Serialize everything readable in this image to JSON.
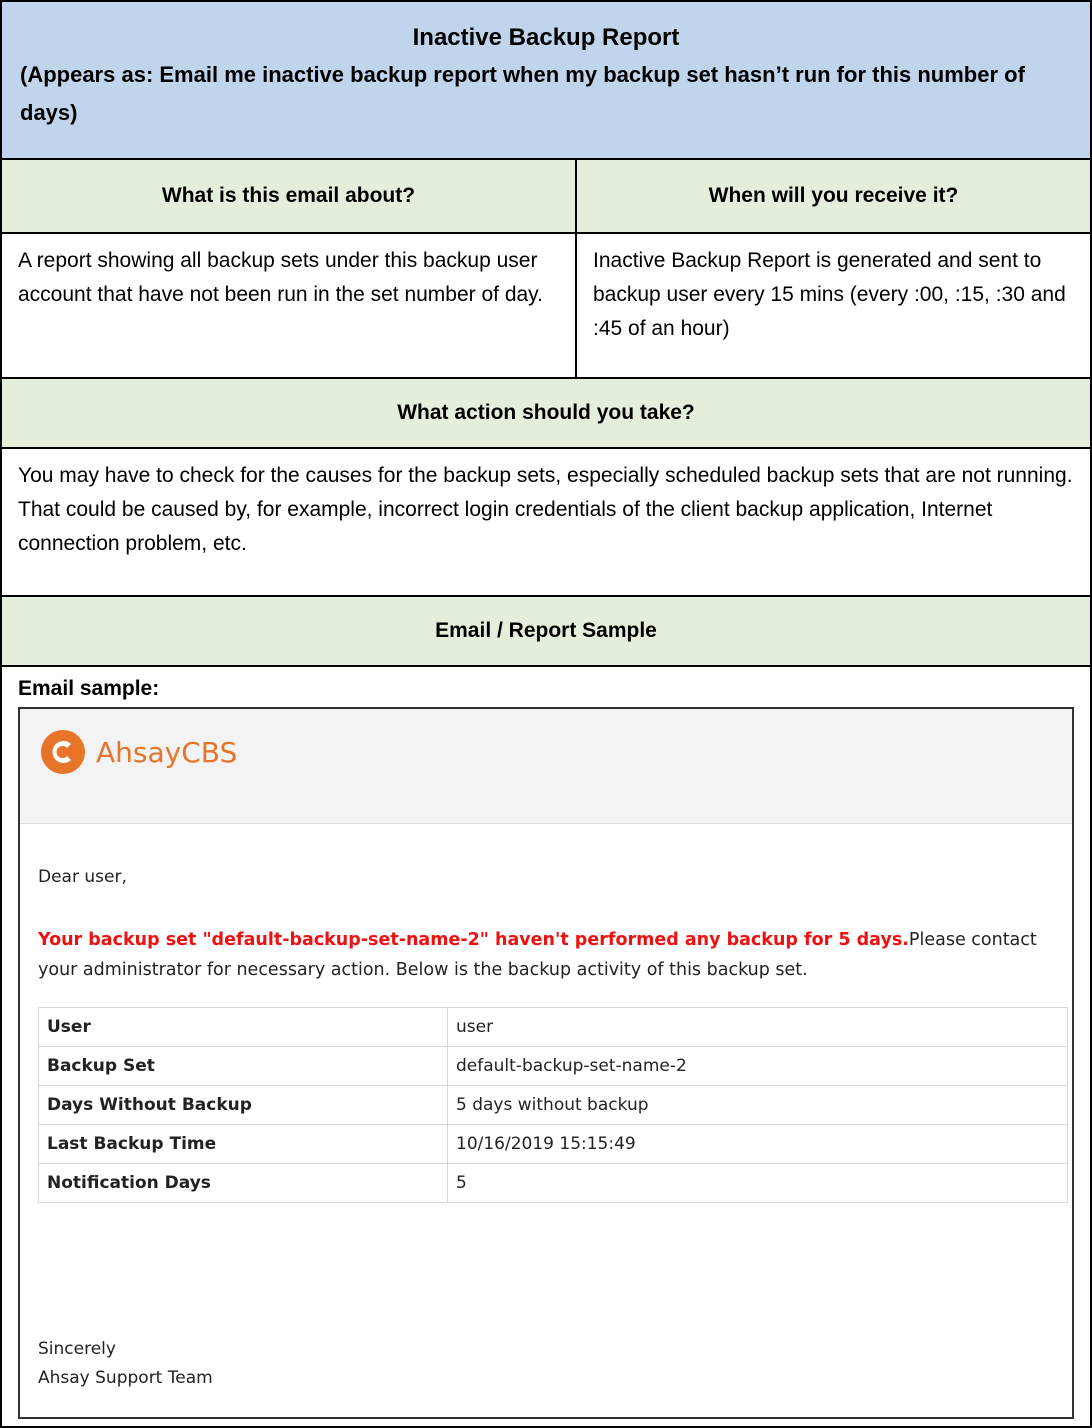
{
  "title": {
    "main": "Inactive Backup Report",
    "appears_as": "(Appears as: Email me inactive backup report when my backup set hasn’t run for this number of days)"
  },
  "columns": {
    "about_header": "What is this email about?",
    "when_header": "When will you receive it?",
    "about_text": "A report showing all backup sets under this backup user account that have not been run in the set number of day.",
    "when_text": "Inactive Backup Report is generated and sent to backup user every 15 mins (every :00, :15, :30 and :45 of an hour)"
  },
  "action": {
    "header": "What action should you take?",
    "text": "You may have to check for the causes for the backup sets, especially scheduled backup sets that are not running. That could be caused by, for example,  incorrect login credentials of the client backup application, Internet connection problem, etc."
  },
  "sample": {
    "header": "Email / Report Sample",
    "label": "Email sample:"
  },
  "email": {
    "logo_text": "AhsayCBS",
    "logo_icon": "ahsay-c-logo-icon",
    "brand_color": "#e8742a",
    "greeting": "Dear user,",
    "alert_text": "Your backup set \"default-backup-set-name-2\" haven't performed any backup for 5 days.",
    "alert_color": "#ee1111",
    "body_text": "Please contact your administrator for necessary action. Below is the backup activity of this backup set.",
    "rows": [
      {
        "key": "User",
        "value": "user"
      },
      {
        "key": "Backup Set",
        "value": "default-backup-set-name-2"
      },
      {
        "key": "Days Without Backup",
        "value": "5 days without backup"
      },
      {
        "key": "Last Backup Time",
        "value": "10/16/2019 15:15:49"
      },
      {
        "key": "Notification Days",
        "value": "5"
      }
    ],
    "sign_line1": "Sincerely",
    "sign_line2": "Ahsay Support Team"
  }
}
